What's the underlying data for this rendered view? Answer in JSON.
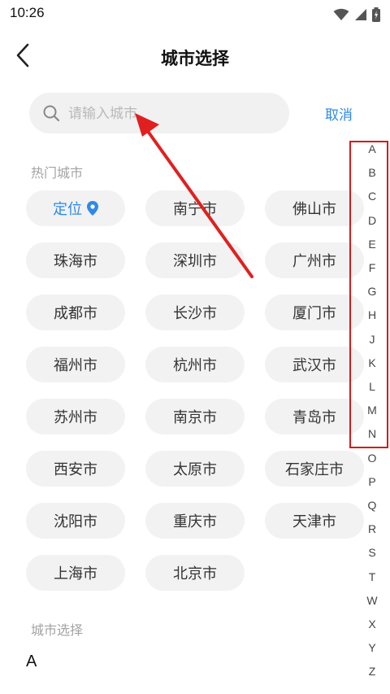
{
  "status_bar": {
    "time": "10:26"
  },
  "header": {
    "title": "城市选择"
  },
  "search": {
    "placeholder": "请输入城市",
    "value": "",
    "cancel_label": "取消"
  },
  "hot_cities": {
    "label": "热门城市",
    "location_label": "定位",
    "items": [
      "南宁市",
      "佛山市",
      "珠海市",
      "深圳市",
      "广州市",
      "成都市",
      "长沙市",
      "厦门市",
      "福州市",
      "杭州市",
      "武汉市",
      "苏州市",
      "南京市",
      "青岛市",
      "西安市",
      "太原市",
      "石家庄市",
      "沈阳市",
      "重庆市",
      "天津市",
      "上海市",
      "北京市"
    ]
  },
  "city_select": {
    "label": "城市选择",
    "current_letter": "A"
  },
  "alphabet": [
    "A",
    "B",
    "C",
    "D",
    "E",
    "F",
    "G",
    "H",
    "J",
    "K",
    "L",
    "M",
    "N",
    "O",
    "P",
    "Q",
    "R",
    "S",
    "T",
    "W",
    "X",
    "Y",
    "Z"
  ],
  "colors": {
    "accent": "#2e8ae6",
    "annotation": "#e02020",
    "chip_bg": "#f2f2f2"
  }
}
